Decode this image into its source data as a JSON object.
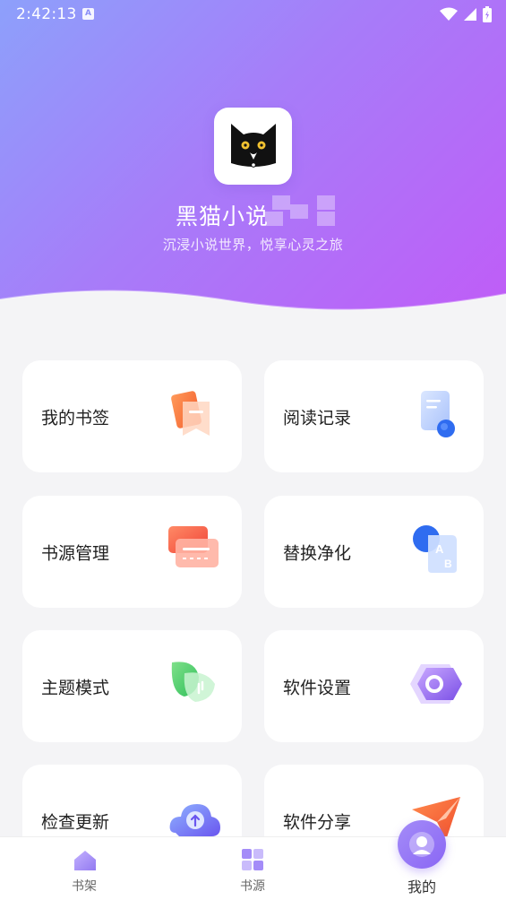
{
  "status_bar": {
    "time": "2:42:13",
    "indicator": "A",
    "icons": [
      "wifi-icon",
      "signal-icon",
      "battery-icon"
    ]
  },
  "app": {
    "name": "黑猫小说",
    "slogan": "沉浸小说世界，悦享心灵之旅"
  },
  "menu": [
    {
      "label": "我的书签",
      "icon": "bookmark-icon"
    },
    {
      "label": "阅读记录",
      "icon": "reading-history-icon"
    },
    {
      "label": "书源管理",
      "icon": "book-source-manage-icon"
    },
    {
      "label": "替换净化",
      "icon": "replace-purify-icon"
    },
    {
      "label": "主题模式",
      "icon": "theme-mode-icon"
    },
    {
      "label": "软件设置",
      "icon": "settings-icon"
    },
    {
      "label": "检查更新",
      "icon": "check-update-icon"
    },
    {
      "label": "软件分享",
      "icon": "share-icon"
    }
  ],
  "bottom_nav": [
    {
      "label": "书架",
      "icon": "bookshelf-icon",
      "active": false
    },
    {
      "label": "书源",
      "icon": "book-source-icon",
      "active": false
    },
    {
      "label": "我的",
      "icon": "profile-icon",
      "active": true
    }
  ],
  "colors": {
    "hero_start": "#8da0fb",
    "hero_end": "#c05cf7",
    "accent": "#8a66f4",
    "background": "#f4f4f6"
  }
}
